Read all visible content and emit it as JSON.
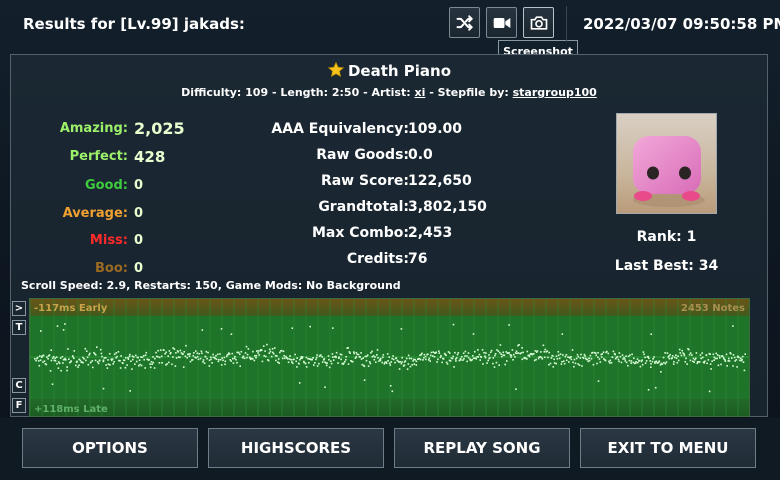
{
  "header": {
    "results_title": "Results for [Lv.99] jakads:",
    "datetime": "2022/03/07 09:50:58 PM",
    "tooltip": "Screenshot",
    "icons": [
      "shuffle-icon",
      "video-camera-icon",
      "camera-icon"
    ]
  },
  "song": {
    "title": "Death Piano",
    "difficulty_label": "Difficulty:",
    "difficulty": "109",
    "length_label": "Length:",
    "length": "2:50",
    "artist_label": "Artist:",
    "artist": "xi",
    "stepfile_label": "Stepfile by:",
    "stepfile_by": "stargroup100",
    "separator": " - "
  },
  "judgements": [
    {
      "label": "Amazing:",
      "value": "2,025",
      "color": "#9cf06a"
    },
    {
      "label": "Perfect:",
      "value": "428",
      "color": "#9cf06a"
    },
    {
      "label": "Good:",
      "value": "0",
      "color": "#3ecc3e"
    },
    {
      "label": "Average:",
      "value": "0",
      "color": "#f0a030"
    },
    {
      "label": "Miss:",
      "value": "0",
      "color": "#ff2a2a"
    },
    {
      "label": "Boo:",
      "value": "0",
      "color": "#9a6a22"
    }
  ],
  "stats": [
    {
      "label": "AAA Equivalency:",
      "value": "109.00"
    },
    {
      "label": "Raw Goods:",
      "value": "0.0"
    },
    {
      "label": "Raw Score:",
      "value": "122,650"
    },
    {
      "label": "Grandtotal:",
      "value": "3,802,150"
    },
    {
      "label": "Max Combo:",
      "value": "2,453"
    },
    {
      "label": "Credits:",
      "value": "76"
    }
  ],
  "player": {
    "rank": "Rank: 1",
    "last_best": "Last Best: 34"
  },
  "scroll_info": "Scroll Speed: 2.9, Restarts: 150, Game Mods: No Background",
  "graph": {
    "early_label": "-117ms Early",
    "late_label": "+118ms Late",
    "notes_label": "2453 Notes",
    "note_count": 2453,
    "side_buttons": [
      ">",
      "T",
      "C",
      "F"
    ],
    "colors": {
      "early_band": "#5a4a1a",
      "center": "#1f7a2a",
      "points": "#d8ffd8"
    }
  },
  "buttons": {
    "options": "OPTIONS",
    "highscores": "HIGHSCORES",
    "replay": "REPLAY SONG",
    "exit": "EXIT TO MENU"
  }
}
